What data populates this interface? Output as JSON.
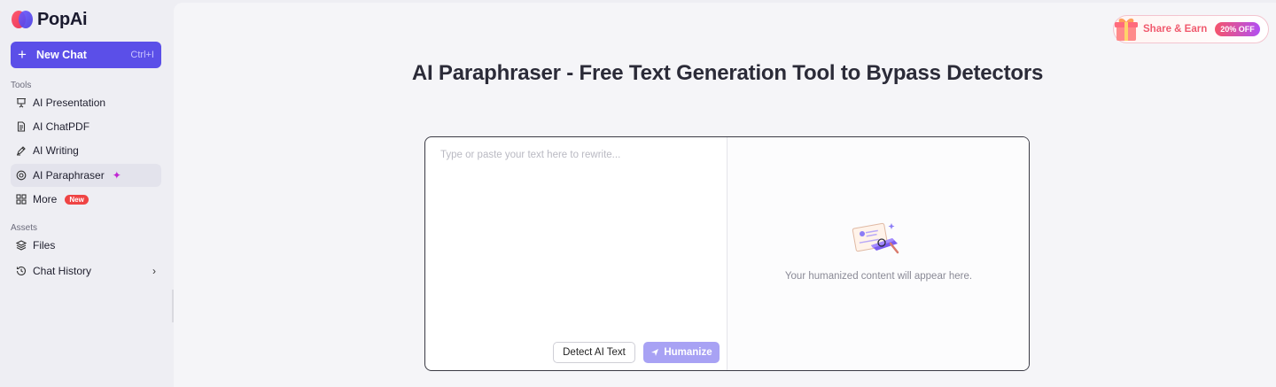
{
  "app": {
    "name": "PopAi"
  },
  "sidebar": {
    "new_chat": {
      "label": "New Chat",
      "shortcut": "Ctrl+I"
    },
    "tools_label": "Tools",
    "tools": [
      {
        "label": "AI Presentation",
        "icon": "presentation-icon"
      },
      {
        "label": "AI ChatPDF",
        "icon": "document-icon"
      },
      {
        "label": "AI Writing",
        "icon": "pen-icon"
      },
      {
        "label": "AI Paraphraser",
        "icon": "target-icon",
        "active": true
      },
      {
        "label": "More",
        "icon": "grid-icon",
        "badge": "New"
      }
    ],
    "assets_label": "Assets",
    "assets": [
      {
        "label": "Files",
        "icon": "layers-icon"
      },
      {
        "label": "Chat History",
        "icon": "history-icon"
      }
    ]
  },
  "promo": {
    "label": "Share & Earn",
    "discount": "20% OFF"
  },
  "page": {
    "title": "AI Paraphraser - Free Text Generation Tool to Bypass Detectors",
    "input_placeholder": "Type or paste your text here to rewrite...",
    "detect_button": "Detect AI Text",
    "humanize_button": "Humanize",
    "output_placeholder": "Your humanized content will appear here."
  },
  "colors": {
    "accent": "#5b4fe8",
    "humanize_disabled": "#a8a2f4",
    "badge_new": "#ef4444",
    "promo_text": "#f05a6e"
  }
}
